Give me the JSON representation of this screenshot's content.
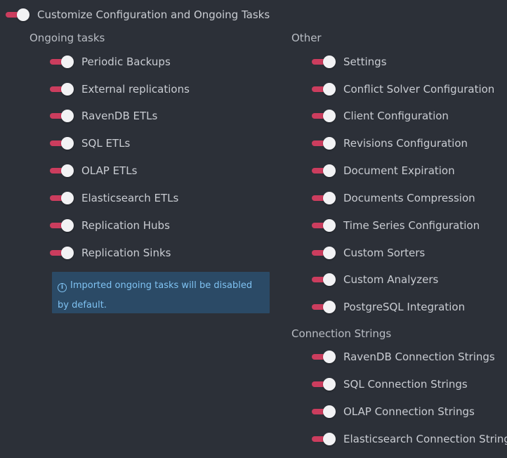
{
  "main_toggle": {
    "label": "Customize Configuration and Ongoing Tasks",
    "on": true
  },
  "ongoing": {
    "title": "Ongoing tasks",
    "items": [
      {
        "label": "Periodic Backups",
        "on": true
      },
      {
        "label": "External replications",
        "on": true
      },
      {
        "label": "RavenDB ETLs",
        "on": true
      },
      {
        "label": "SQL ETLs",
        "on": true
      },
      {
        "label": "OLAP ETLs",
        "on": true
      },
      {
        "label": "Elasticsearch ETLs",
        "on": true
      },
      {
        "label": "Replication Hubs",
        "on": true
      },
      {
        "label": "Replication Sinks",
        "on": true
      }
    ],
    "info_text": "Imported ongoing tasks will be disabled by default."
  },
  "other": {
    "title": "Other",
    "items": [
      {
        "label": "Settings",
        "on": true
      },
      {
        "label": "Conflict Solver Configuration",
        "on": true
      },
      {
        "label": "Client Configuration",
        "on": true
      },
      {
        "label": "Revisions Configuration",
        "on": true
      },
      {
        "label": "Document Expiration",
        "on": true
      },
      {
        "label": "Documents Compression",
        "on": true
      },
      {
        "label": "Time Series Configuration",
        "on": true
      },
      {
        "label": "Custom Sorters",
        "on": true
      },
      {
        "label": "Custom Analyzers",
        "on": true
      },
      {
        "label": "PostgreSQL Integration",
        "on": true
      }
    ]
  },
  "connection_strings": {
    "title": "Connection Strings",
    "items": [
      {
        "label": "RavenDB Connection Strings",
        "on": true
      },
      {
        "label": "SQL Connection Strings",
        "on": true
      },
      {
        "label": "OLAP Connection Strings",
        "on": true
      },
      {
        "label": "Elasticsearch Connection Strings",
        "on": true
      }
    ]
  },
  "colors": {
    "background": "#2c3038",
    "toggle_on": "#cc3d5e",
    "info_bg": "#2b4a66",
    "info_text": "#7fc2f2"
  }
}
